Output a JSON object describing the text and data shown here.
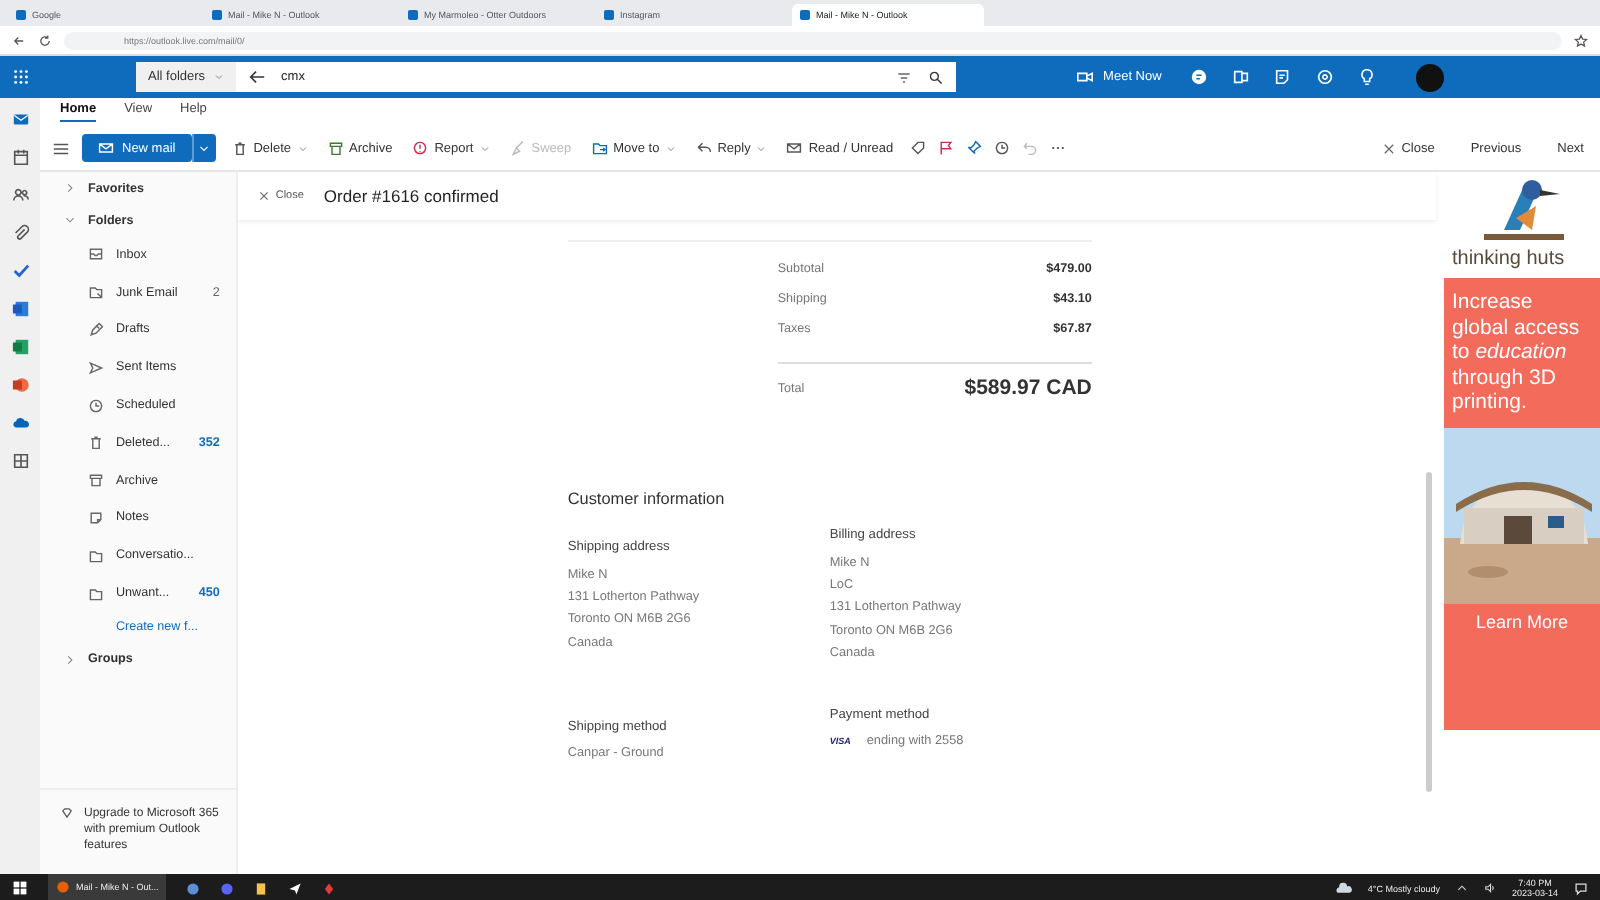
{
  "browser": {
    "tabs": [
      {
        "title": "Google",
        "selected": false
      },
      {
        "title": "Mail - Mike N - Outlook",
        "selected": false
      },
      {
        "title": "My Marmoleo - Otter Outdoors",
        "selected": false
      },
      {
        "title": "Instagram",
        "selected": false
      },
      {
        "title": "Mail - Mike N - Outlook",
        "selected": true
      }
    ],
    "url": "https://outlook.live.com/mail/0/"
  },
  "header": {
    "scope": "All folders",
    "search": "cmx",
    "meet_now": "Meet Now"
  },
  "ribbon": {
    "tabs": [
      {
        "label": "Home",
        "selected": true
      },
      {
        "label": "View",
        "selected": false
      },
      {
        "label": "Help",
        "selected": false
      }
    ],
    "new_mail": "New mail",
    "actions": [
      {
        "label": "Delete",
        "dropdown": true,
        "disabled": false
      },
      {
        "label": "Archive",
        "dropdown": false,
        "disabled": false
      },
      {
        "label": "Report",
        "dropdown": true,
        "disabled": false
      },
      {
        "label": "Sweep",
        "dropdown": false,
        "disabled": true
      },
      {
        "label": "Move to",
        "dropdown": true,
        "disabled": false
      },
      {
        "label": "Reply",
        "dropdown": true,
        "disabled": false
      },
      {
        "label": "Read / Unread",
        "dropdown": false,
        "disabled": false
      }
    ],
    "close": "Close",
    "previous": "Previous",
    "next": "Next"
  },
  "folders": {
    "sections": [
      {
        "label": "Favorites",
        "expanded": false
      },
      {
        "label": "Folders",
        "expanded": true,
        "children": [
          {
            "name": "Inbox"
          },
          {
            "name": "Junk Email",
            "count": "2",
            "unread": false
          },
          {
            "name": "Drafts"
          },
          {
            "name": "Sent Items"
          },
          {
            "name": "Scheduled"
          },
          {
            "name": "Deleted...",
            "count": "352",
            "unread": true
          },
          {
            "name": "Archive"
          },
          {
            "name": "Notes"
          },
          {
            "name": "Conversatio..."
          },
          {
            "name": "Unwant...",
            "count": "450",
            "unread": true
          }
        ]
      },
      {
        "label": "Groups",
        "expanded": false
      }
    ],
    "create_new": "Create new f...",
    "upgrade": "Upgrade to Microsoft 365 with premium Outlook features"
  },
  "message": {
    "close": "Close",
    "subject": "Order #1616 confirmed",
    "summary": [
      {
        "label": "Subtotal",
        "value": "$479.00"
      },
      {
        "label": "Shipping",
        "value": "$43.10"
      },
      {
        "label": "Taxes",
        "value": "$67.87"
      }
    ],
    "total": {
      "label": "Total",
      "value": "$589.97 CAD"
    },
    "customer_title": "Customer information",
    "shipping_address": {
      "title": "Shipping address",
      "lines": [
        "Mike N",
        "131 Lotherton Pathway",
        "Toronto ON M6B 2G6",
        "Canada"
      ]
    },
    "billing_address": {
      "title": "Billing address",
      "lines": [
        "Mike N",
        "LoC",
        "131 Lotherton Pathway",
        "Toronto ON M6B 2G6",
        "Canada"
      ]
    },
    "shipping_method": {
      "title": "Shipping method",
      "value": "Canpar - Ground"
    },
    "payment_method": {
      "title": "Payment method",
      "card": "VISA",
      "value": "ending with 2558"
    }
  },
  "ad": {
    "brand": "thinking huts",
    "headline": "Increase global access to *education* through 3D printing.",
    "button": "Learn More"
  },
  "taskbar": {
    "app": "Mail - Mike N - Out...",
    "weather": "4°C  Mostly cloudy",
    "time": "7:40 PM",
    "date": "2023-03-14"
  }
}
